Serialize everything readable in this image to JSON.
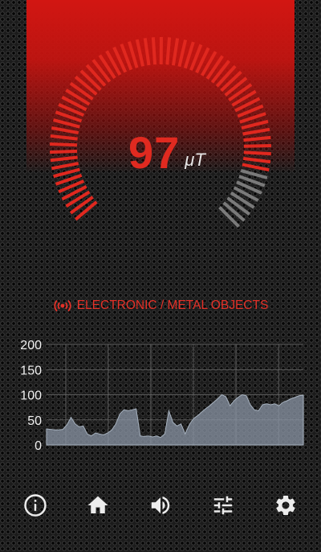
{
  "meter": {
    "value": "97",
    "unit": "μT",
    "level": 0.88
  },
  "status": {
    "label": "ELECTRONIC / METAL OBJECTS",
    "icon": "broadcast-icon",
    "color": "#e53128"
  },
  "chart_data": {
    "type": "area",
    "ylim": [
      0,
      200
    ],
    "y_ticks": [
      "200",
      "150",
      "100",
      "50",
      "0"
    ],
    "x": [
      0,
      1,
      2,
      3,
      4,
      5,
      6,
      7,
      8,
      9,
      10,
      11,
      12,
      13,
      14,
      15,
      16,
      17,
      18,
      19,
      20,
      21,
      22,
      23,
      24,
      25,
      26,
      27,
      28,
      29,
      30,
      31,
      32,
      33,
      34,
      35,
      36,
      37,
      38,
      39,
      40,
      41,
      42,
      43,
      44,
      45,
      46,
      47,
      48,
      49,
      50,
      51,
      52,
      53,
      54,
      55,
      56,
      57,
      58,
      59,
      60,
      61,
      62,
      63
    ],
    "series": [
      {
        "values": [
          32,
          31,
          30,
          30,
          31,
          40,
          55,
          42,
          36,
          38,
          22,
          18,
          24,
          22,
          20,
          24,
          30,
          42,
          62,
          70,
          68,
          70,
          72,
          18,
          17,
          18,
          16,
          18,
          15,
          22,
          68,
          45,
          38,
          42,
          22,
          40,
          52,
          58,
          65,
          72,
          78,
          85,
          92,
          100,
          96,
          78,
          88,
          95,
          100,
          98,
          80,
          70,
          68,
          80,
          82,
          80,
          82,
          78,
          85,
          88,
          92,
          95,
          98,
          99
        ]
      }
    ],
    "grid": true,
    "area_color": "#8b96a5",
    "accent": "#e0281f"
  },
  "nav": {
    "items": [
      {
        "icon": "info-icon"
      },
      {
        "icon": "home-icon"
      },
      {
        "icon": "volume-icon"
      },
      {
        "icon": "sliders-icon"
      },
      {
        "icon": "gear-icon"
      }
    ]
  }
}
